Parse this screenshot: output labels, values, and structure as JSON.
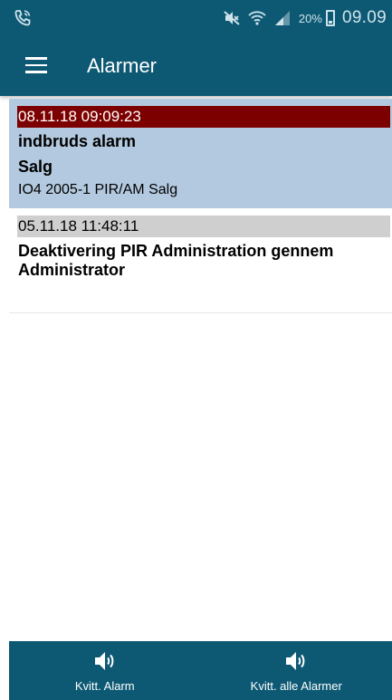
{
  "status_bar": {
    "battery_percent": "20%",
    "clock": "09.09",
    "icons": [
      "phone-call-icon",
      "mute-icon",
      "wifi-icon",
      "signal-icon",
      "battery-icon"
    ]
  },
  "app_bar": {
    "title": "Alarmer",
    "menu_icon": "hamburger-menu-icon"
  },
  "alarms": [
    {
      "date": "08.11.18 09:09:23",
      "title": "indbruds alarm",
      "area": "Salg",
      "detail": "IO4 2005-1 PIR/AM Salg",
      "status": "active"
    },
    {
      "date": "05.11.18 11:48:11",
      "title": "Deaktivering PIR Administration gennem Administrator",
      "status": "inactive"
    }
  ],
  "bottom_bar": {
    "ack_alarm_label": "Kvitt. Alarm",
    "ack_all_label": "Kvitt. alle Alarmer",
    "icon": "speaker-icon"
  },
  "colors": {
    "primary": "#0d5974",
    "selected_row": "#b3c9df",
    "active_date": "#7d0000",
    "inactive_date": "#cfcfcf"
  }
}
